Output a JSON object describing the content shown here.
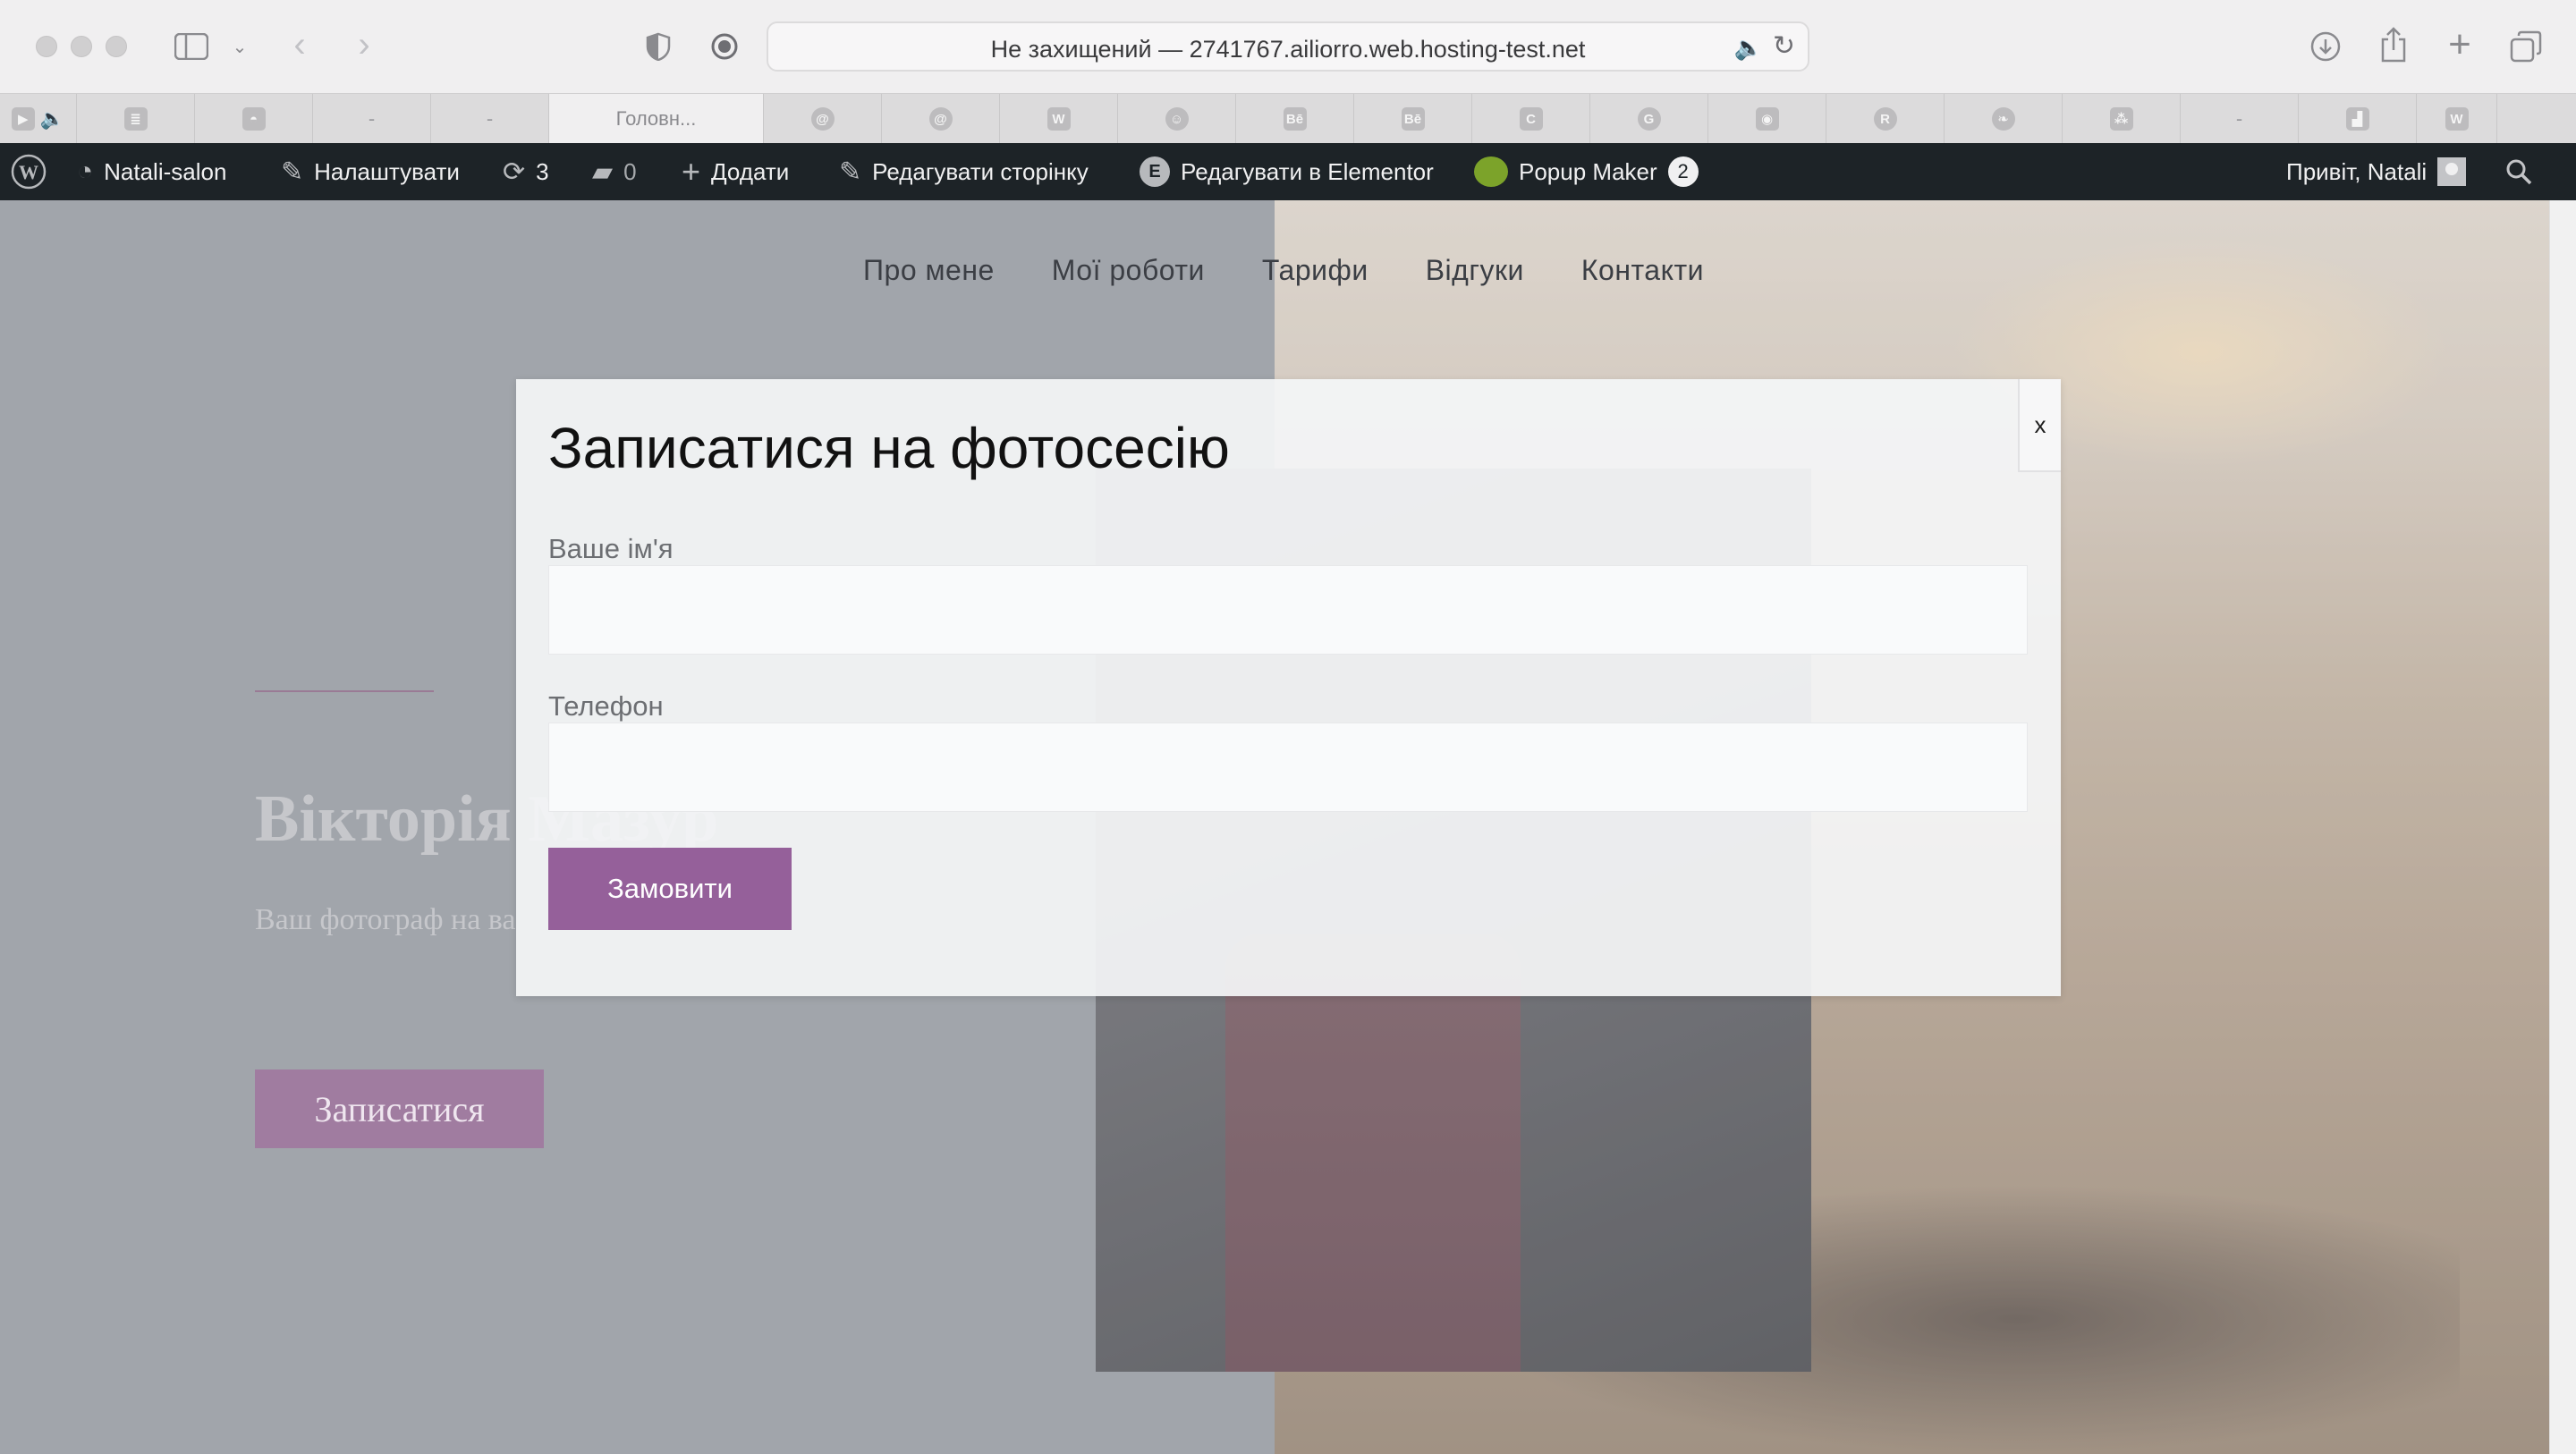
{
  "browser": {
    "url_text": "Не захищений — 2741767.ailiorro.web.hosting-test.net",
    "active_tab_label": "Головн..."
  },
  "tabs": [
    {
      "icon": "youtube-icon",
      "glyph": "▶"
    },
    {
      "icon": "list-icon",
      "glyph": "≣"
    },
    {
      "icon": "bubble-icon",
      "glyph": "◓"
    },
    {
      "icon": "blank-tab-icon",
      "glyph": "-"
    },
    {
      "icon": "blank-tab-icon",
      "glyph": "-"
    },
    {
      "icon": "site-icon",
      "glyph": "",
      "label": "Головн..."
    },
    {
      "icon": "spiral-icon",
      "glyph": "@"
    },
    {
      "icon": "spiral-icon",
      "glyph": "@"
    },
    {
      "icon": "w-icon",
      "glyph": "W"
    },
    {
      "icon": "face-icon",
      "glyph": "☺"
    },
    {
      "icon": "behance-icon",
      "glyph": "Bē"
    },
    {
      "icon": "behance-icon",
      "glyph": "Bē"
    },
    {
      "icon": "c-icon",
      "glyph": "C"
    },
    {
      "icon": "google-icon",
      "glyph": "G"
    },
    {
      "icon": "camera-icon",
      "glyph": "◉"
    },
    {
      "icon": "r-icon",
      "glyph": "R"
    },
    {
      "icon": "leaf-icon",
      "glyph": "❧"
    },
    {
      "icon": "dots-icon",
      "glyph": "⁂"
    },
    {
      "icon": "blank-tab-icon",
      "glyph": "-"
    },
    {
      "icon": "unsplash-icon",
      "glyph": "▟"
    },
    {
      "icon": "w-icon",
      "glyph": "W"
    }
  ],
  "adminbar": {
    "site_name": "Natali-salon",
    "customize": "Налаштувати",
    "updates_count": "3",
    "comments_count": "0",
    "add_new": "Додати",
    "edit_page": "Редагувати сторінку",
    "edit_elementor": "Редагувати в Elementor",
    "popup_maker": "Popup Maker",
    "popup_maker_count": "2",
    "greeting": "Привіт, Natali"
  },
  "site": {
    "nav": [
      "Про мене",
      "Мої роботи",
      "Тарифи",
      "Відгуки",
      "Контакти"
    ],
    "hero_title": "Вікторія Мазур",
    "hero_subtitle": "Ваш фотограф на ва",
    "hero_button": "Записатися"
  },
  "popup": {
    "title": "Записатися на фотосесію",
    "close_label": "x",
    "name_label": "Ваше ім'я",
    "name_value": "",
    "phone_label": "Телефон",
    "phone_value": "",
    "submit_label": "Замовити"
  },
  "colors": {
    "accent": "#95609a",
    "adminbar_bg": "#1d2327",
    "overlay": "#8e9299"
  }
}
